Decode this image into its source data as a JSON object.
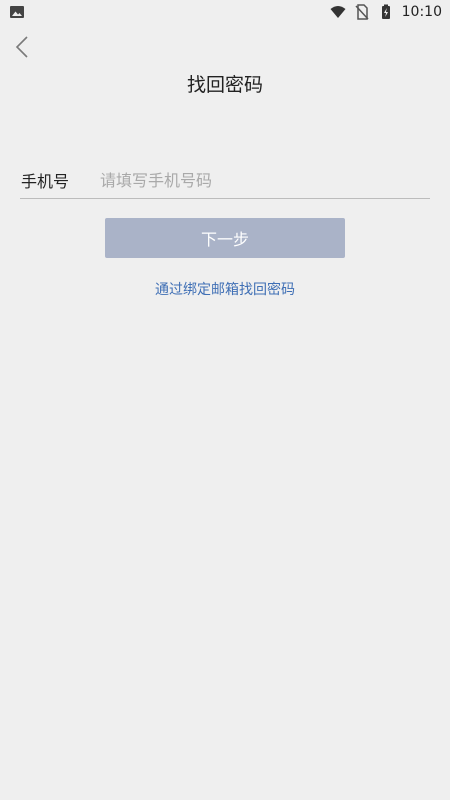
{
  "status_bar": {
    "time": "10:10",
    "icons": [
      "image-icon",
      "wifi-icon",
      "no-sim-icon",
      "battery-charging-icon"
    ]
  },
  "header": {
    "back_icon": "chevron-left-icon",
    "title": "找回密码"
  },
  "form": {
    "phone_label": "手机号",
    "phone_placeholder": "请填写手机号码",
    "phone_value": ""
  },
  "actions": {
    "next_label": "下一步",
    "email_recovery_link": "通过绑定邮箱找回密码"
  },
  "colors": {
    "background": "#efefef",
    "button_disabled": "#aab3c8",
    "link": "#3f6fb5"
  }
}
